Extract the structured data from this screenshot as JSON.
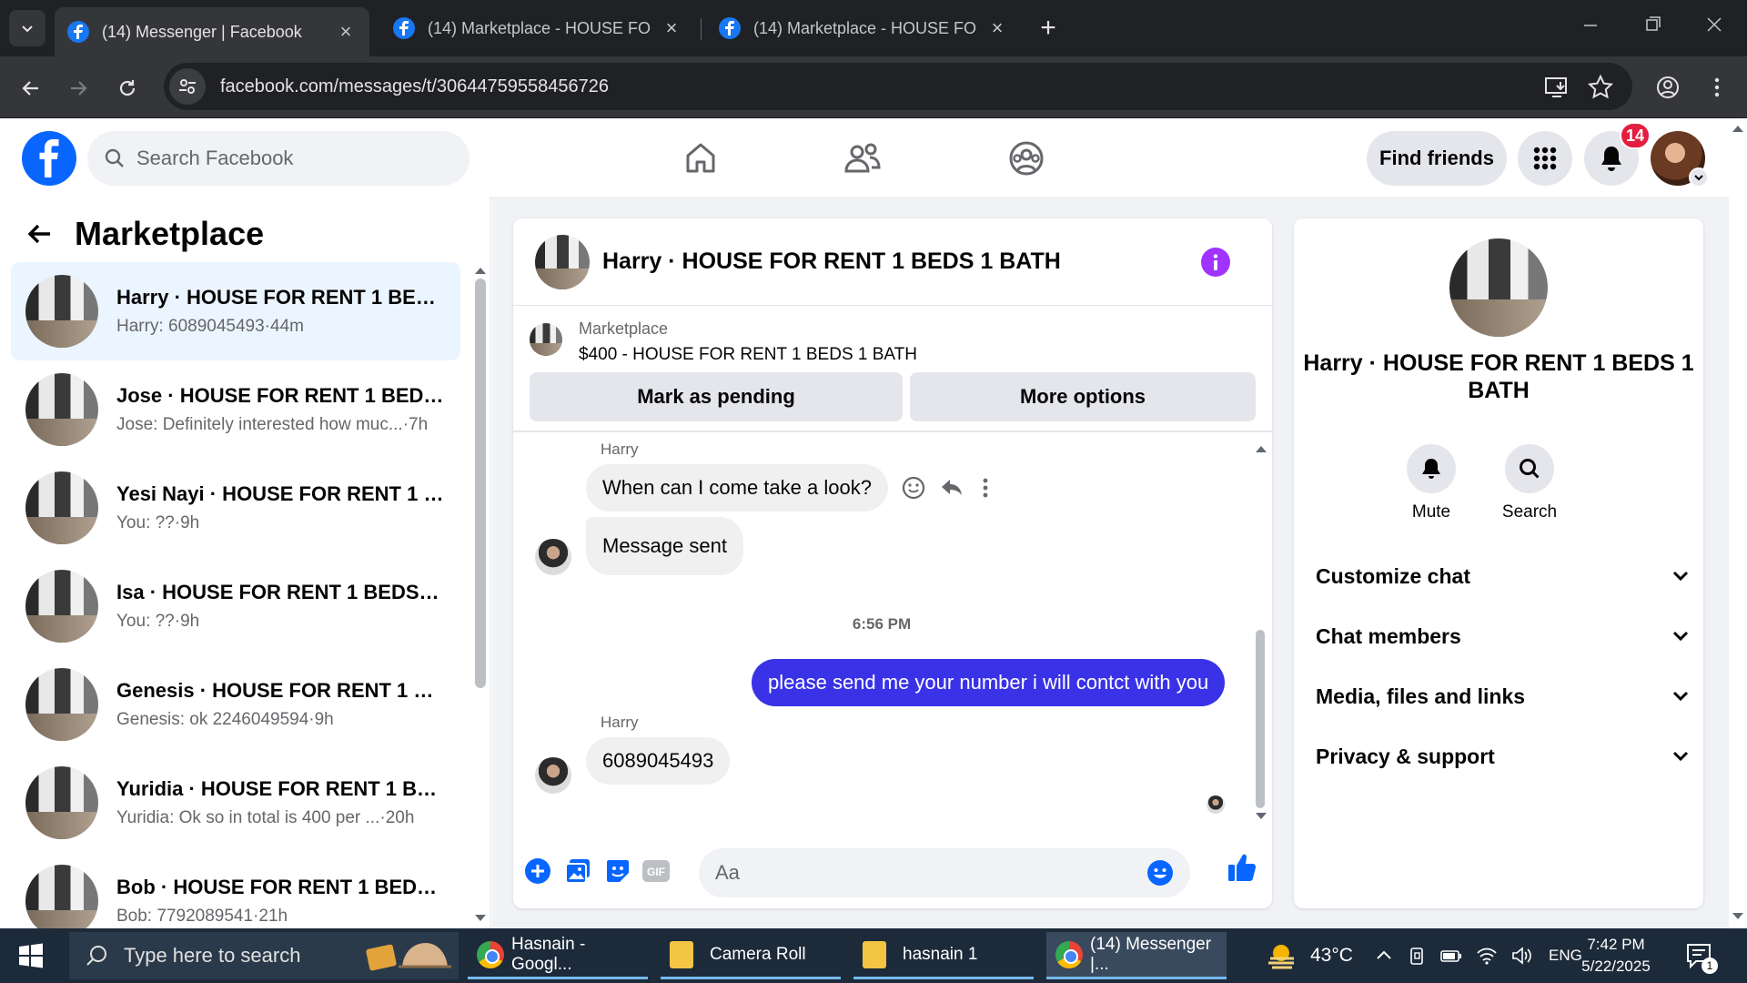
{
  "browser": {
    "tabs": [
      {
        "title": "(14) Messenger | Facebook",
        "active": true
      },
      {
        "title": "(14) Marketplace - HOUSE FOR",
        "active": false
      },
      {
        "title": "(14) Marketplace - HOUSE FOR",
        "active": false
      }
    ],
    "url": "facebook.com/messages/t/30644759558456726"
  },
  "fb_header": {
    "search_placeholder": "Search Facebook",
    "find_friends_label": "Find friends",
    "notification_count": "14"
  },
  "sidebar": {
    "title": "Marketplace",
    "conversations": [
      {
        "name": "Harry · HOUSE FOR RENT 1 BED...",
        "preview": "Harry: 6089045493",
        "time": "·44m",
        "active": true
      },
      {
        "name": "Jose · HOUSE FOR RENT 1 BEDS ...",
        "preview": "Jose: Definitely interested how muc...",
        "time": "·7h",
        "active": false
      },
      {
        "name": "Yesi Nayi · HOUSE FOR RENT 1 B...",
        "preview": "You: ??",
        "time": "·9h",
        "active": false
      },
      {
        "name": "Isa · HOUSE FOR RENT 1 BEDS 1 ...",
        "preview": "You: ??",
        "time": "·9h",
        "active": false
      },
      {
        "name": "Genesis · HOUSE FOR RENT 1 BE...",
        "preview": "Genesis: ok 2246049594",
        "time": "·9h",
        "active": false
      },
      {
        "name": "Yuridia · HOUSE FOR RENT 1 BE...",
        "preview": "Yuridia: Ok so in total is 400 per ...",
        "time": "·20h",
        "active": false
      },
      {
        "name": "Bob · HOUSE FOR RENT 1 BEDS ...",
        "preview": "Bob: 7792089541",
        "time": "·21h",
        "active": false
      }
    ]
  },
  "chat": {
    "title": "Harry · HOUSE FOR RENT 1 BEDS 1 BATH",
    "listing_label": "Marketplace",
    "listing_price": "$400 - HOUSE FOR RENT 1 BEDS 1 BATH",
    "mark_pending_label": "Mark as pending",
    "more_options_label": "More options",
    "messages": {
      "m1_sender": "Harry",
      "m1_text": "When can I come take a look?",
      "m2_text": "Message sent",
      "timestamp": "6:56 PM",
      "m3_text": "please send me your number i will contct with you",
      "m4_sender": "Harry",
      "m4_text": "6089045493"
    },
    "composer_placeholder": "Aa"
  },
  "info_panel": {
    "name": "Harry · HOUSE FOR RENT 1 BEDS 1 BATH",
    "mute_label": "Mute",
    "search_label": "Search",
    "sections": [
      "Customize chat",
      "Chat members",
      "Media, files and links",
      "Privacy & support"
    ]
  },
  "taskbar": {
    "search_hint": "Type here to search",
    "apps": [
      "Hasnain - Googl...",
      "Camera Roll",
      "hasnain 1",
      "(14) Messenger |..."
    ],
    "temperature": "43°C",
    "language": "ENG",
    "time": "7:42 PM",
    "date": "5/22/2025",
    "notification_count": "1"
  },
  "colors": {
    "fb_blue": "#0866ff",
    "outgoing_bubble": "#3a32e6",
    "active_conversation": "#ebf5ff",
    "notification_red": "#e41e3f"
  }
}
